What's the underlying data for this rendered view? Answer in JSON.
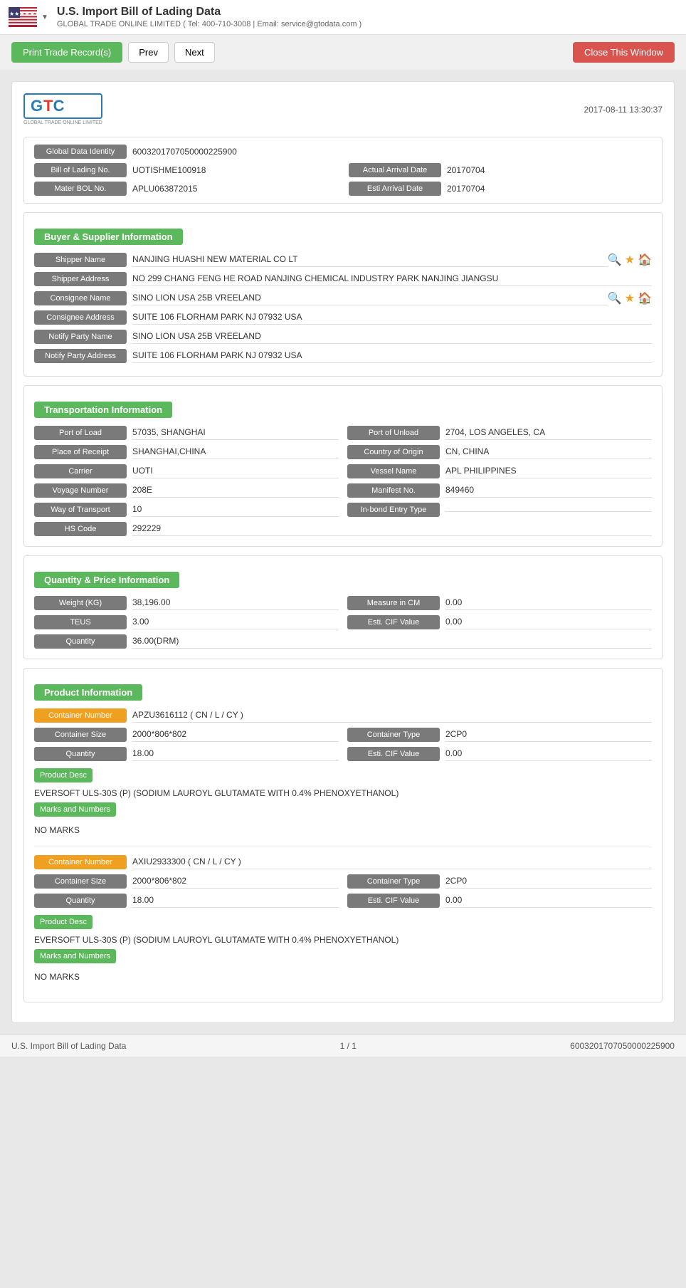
{
  "topbar": {
    "title": "U.S. Import Bill of Lading Data",
    "subtitle": "GLOBAL TRADE ONLINE LIMITED ( Tel: 400-710-3008 | Email: service@gtodata.com )"
  },
  "toolbar": {
    "print_label": "Print Trade Record(s)",
    "prev_label": "Prev",
    "next_label": "Next",
    "close_label": "Close This Window"
  },
  "record": {
    "logo_text": "GTC",
    "logo_subtext": "GLOBAL TRADE ONLINE LIMITED",
    "date": "2017-08-11 13:30:37",
    "global_data_identity_label": "Global Data Identity",
    "global_data_identity_value": "6003201707050000225900",
    "bill_of_lading_label": "Bill of Lading No.",
    "bill_of_lading_value": "UOTISHME100918",
    "actual_arrival_date_label": "Actual Arrival Date",
    "actual_arrival_date_value": "20170704",
    "mater_bol_label": "Mater BOL No.",
    "mater_bol_value": "APLU063872015",
    "esti_arrival_label": "Esti Arrival Date",
    "esti_arrival_value": "20170704"
  },
  "buyer_supplier": {
    "section_title": "Buyer & Supplier Information",
    "shipper_name_label": "Shipper Name",
    "shipper_name_value": "NANJING HUASHI NEW MATERIAL CO LT",
    "shipper_address_label": "Shipper Address",
    "shipper_address_value": "NO 299 CHANG FENG HE ROAD NANJING CHEMICAL INDUSTRY PARK NANJING JIANGSU",
    "consignee_name_label": "Consignee Name",
    "consignee_name_value": "SINO LION USA 25B VREELAND",
    "consignee_address_label": "Consignee Address",
    "consignee_address_value": "SUITE 106 FLORHAM PARK NJ 07932 USA",
    "notify_party_name_label": "Notify Party Name",
    "notify_party_name_value": "SINO LION USA 25B VREELAND",
    "notify_party_address_label": "Notify Party Address",
    "notify_party_address_value": "SUITE 106 FLORHAM PARK NJ 07932 USA"
  },
  "transportation": {
    "section_title": "Transportation Information",
    "port_of_load_label": "Port of Load",
    "port_of_load_value": "57035, SHANGHAI",
    "port_of_unload_label": "Port of Unload",
    "port_of_unload_value": "2704, LOS ANGELES, CA",
    "place_of_receipt_label": "Place of Receipt",
    "place_of_receipt_value": "SHANGHAI,CHINA",
    "country_of_origin_label": "Country of Origin",
    "country_of_origin_value": "CN, CHINA",
    "carrier_label": "Carrier",
    "carrier_value": "UOTI",
    "vessel_name_label": "Vessel Name",
    "vessel_name_value": "APL PHILIPPINES",
    "voyage_number_label": "Voyage Number",
    "voyage_number_value": "208E",
    "manifest_no_label": "Manifest No.",
    "manifest_no_value": "849460",
    "way_of_transport_label": "Way of Transport",
    "way_of_transport_value": "10",
    "inbond_entry_label": "In-bond Entry Type",
    "inbond_entry_value": "",
    "hs_code_label": "HS Code",
    "hs_code_value": "292229"
  },
  "quantity_price": {
    "section_title": "Quantity & Price Information",
    "weight_label": "Weight (KG)",
    "weight_value": "38,196.00",
    "measure_label": "Measure in CM",
    "measure_value": "0.00",
    "teus_label": "TEUS",
    "teus_value": "3.00",
    "esti_cif_label": "Esti. CIF Value",
    "esti_cif_value": "0.00",
    "quantity_label": "Quantity",
    "quantity_value": "36.00(DRM)"
  },
  "product_info": {
    "section_title": "Product Information",
    "containers": [
      {
        "container_number_label": "Container Number",
        "container_number_value": "APZU3616112 ( CN / L / CY )",
        "container_size_label": "Container Size",
        "container_size_value": "2000*806*802",
        "container_type_label": "Container Type",
        "container_type_value": "2CP0",
        "quantity_label": "Quantity",
        "quantity_value": "18.00",
        "esti_cif_label": "Esti. CIF Value",
        "esti_cif_value": "0.00",
        "product_desc_label": "Product Desc",
        "product_desc_value": "EVERSOFT ULS-30S (P) (SODIUM LAUROYL GLUTAMATE WITH 0.4% PHENOXYETHANOL)",
        "marks_label": "Marks and Numbers",
        "marks_value": "NO MARKS"
      },
      {
        "container_number_label": "Container Number",
        "container_number_value": "AXIU2933300 ( CN / L / CY )",
        "container_size_label": "Container Size",
        "container_size_value": "2000*806*802",
        "container_type_label": "Container Type",
        "container_type_value": "2CP0",
        "quantity_label": "Quantity",
        "quantity_value": "18.00",
        "esti_cif_label": "Esti. CIF Value",
        "esti_cif_value": "0.00",
        "product_desc_label": "Product Desc",
        "product_desc_value": "EVERSOFT ULS-30S (P) (SODIUM LAUROYL GLUTAMATE WITH 0.4% PHENOXYETHANOL)",
        "marks_label": "Marks and Numbers",
        "marks_value": "NO MARKS"
      }
    ]
  },
  "footer": {
    "left": "U.S. Import Bill of Lading Data",
    "middle": "1 / 1",
    "right": "6003201707050000225900"
  }
}
